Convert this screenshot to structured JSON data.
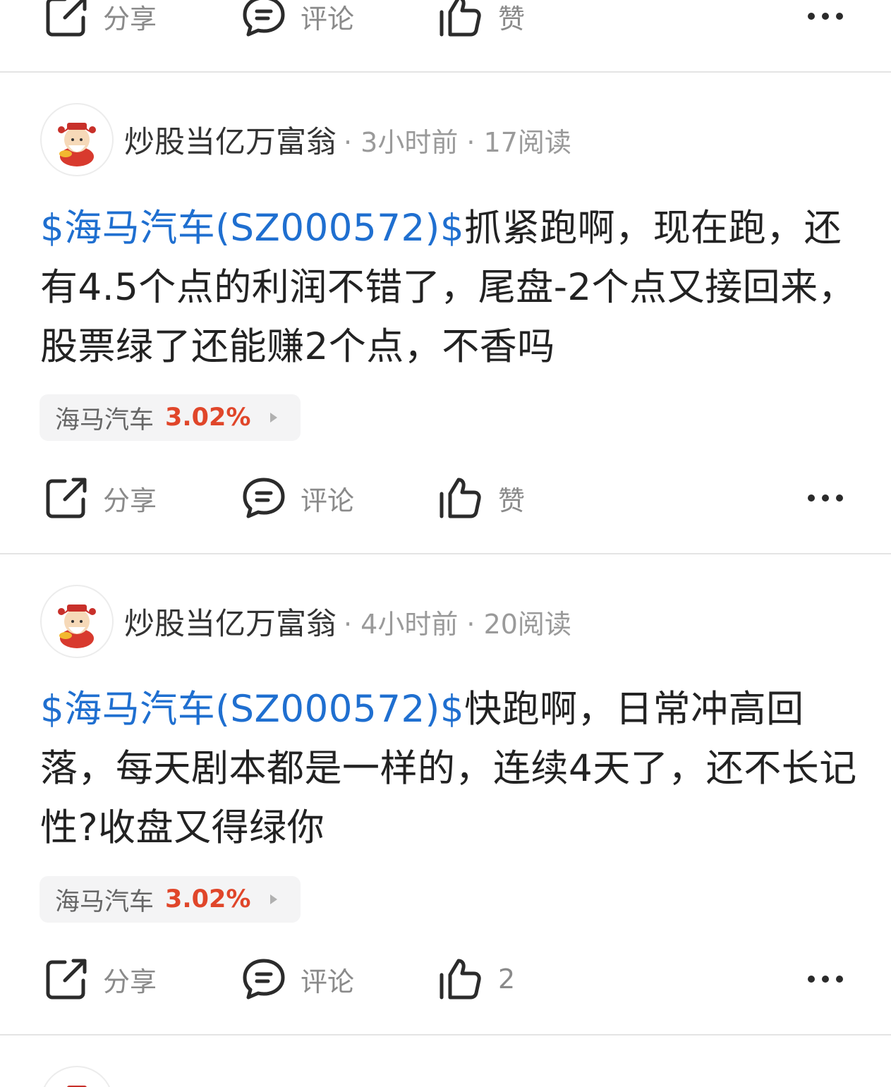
{
  "actions_labels": {
    "share": "分享",
    "comment": "评论",
    "like": "赞"
  },
  "top_actions": {
    "like_label": "赞"
  },
  "posts": [
    {
      "author": "炒股当亿万富翁",
      "info": "· 3小时前 · 17阅读",
      "stock_link": "$海马汽车(SZ000572)$",
      "text": "抓紧跑啊，现在跑，还有4.5个点的利润不错了，尾盘-2个点又接回来，股票绿了还能赚2个点，不香吗",
      "tag_name": "海马汽车",
      "tag_pct": "3.02%",
      "like_label": "赞"
    },
    {
      "author": "炒股当亿万富翁",
      "info": "· 4小时前 · 20阅读",
      "stock_link": "$海马汽车(SZ000572)$",
      "text": "快跑啊，日常冲高回落，每天剧本都是一样的，连续4天了，还不长记性?收盘又得绿你",
      "tag_name": "海马汽车",
      "tag_pct": "3.02%",
      "like_label": "2"
    }
  ],
  "colors": {
    "stock_link": "#1f6fd0",
    "percent_up": "#e0462a",
    "muted": "#9a9a9a"
  },
  "icons": [
    "share-icon",
    "comment-icon",
    "like-icon",
    "more-icon",
    "avatar-god-of-wealth"
  ]
}
